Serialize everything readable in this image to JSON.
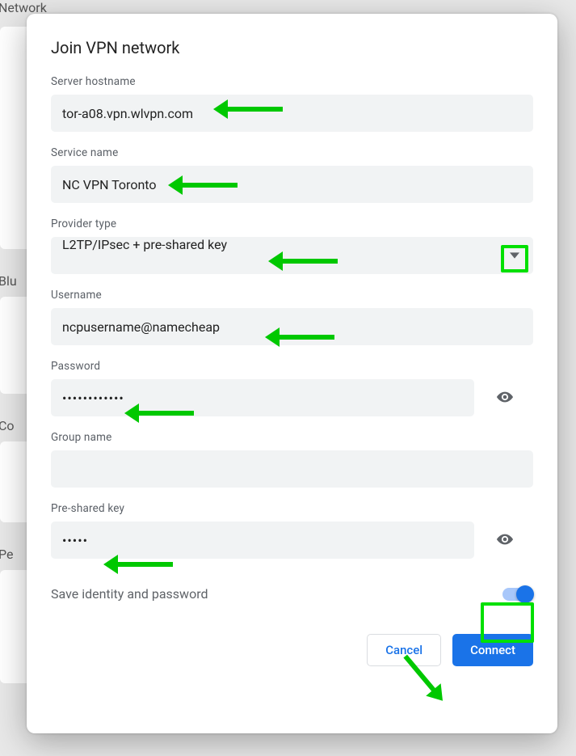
{
  "background": {
    "section1": "Network",
    "section2": "Blu",
    "section3": "Co",
    "section4": "Pe"
  },
  "dialog": {
    "title": "Join VPN network",
    "fields": {
      "server_hostname": {
        "label": "Server hostname",
        "value": "tor-a08.vpn.wlvpn.com"
      },
      "service_name": {
        "label": "Service name",
        "value": "NC VPN Toronto"
      },
      "provider_type": {
        "label": "Provider type",
        "value": "L2TP/IPsec + pre-shared key"
      },
      "username": {
        "label": "Username",
        "value": "ncpusername@namecheap"
      },
      "password": {
        "label": "Password",
        "masked_value": "••••••••••••"
      },
      "group_name": {
        "label": "Group name",
        "value": ""
      },
      "psk": {
        "label": "Pre-shared key",
        "masked_value": "•••••"
      }
    },
    "save_toggle": {
      "label": "Save identity and password",
      "on": true
    },
    "actions": {
      "cancel": "Cancel",
      "connect": "Connect"
    }
  },
  "annotation_color": "#00c800"
}
